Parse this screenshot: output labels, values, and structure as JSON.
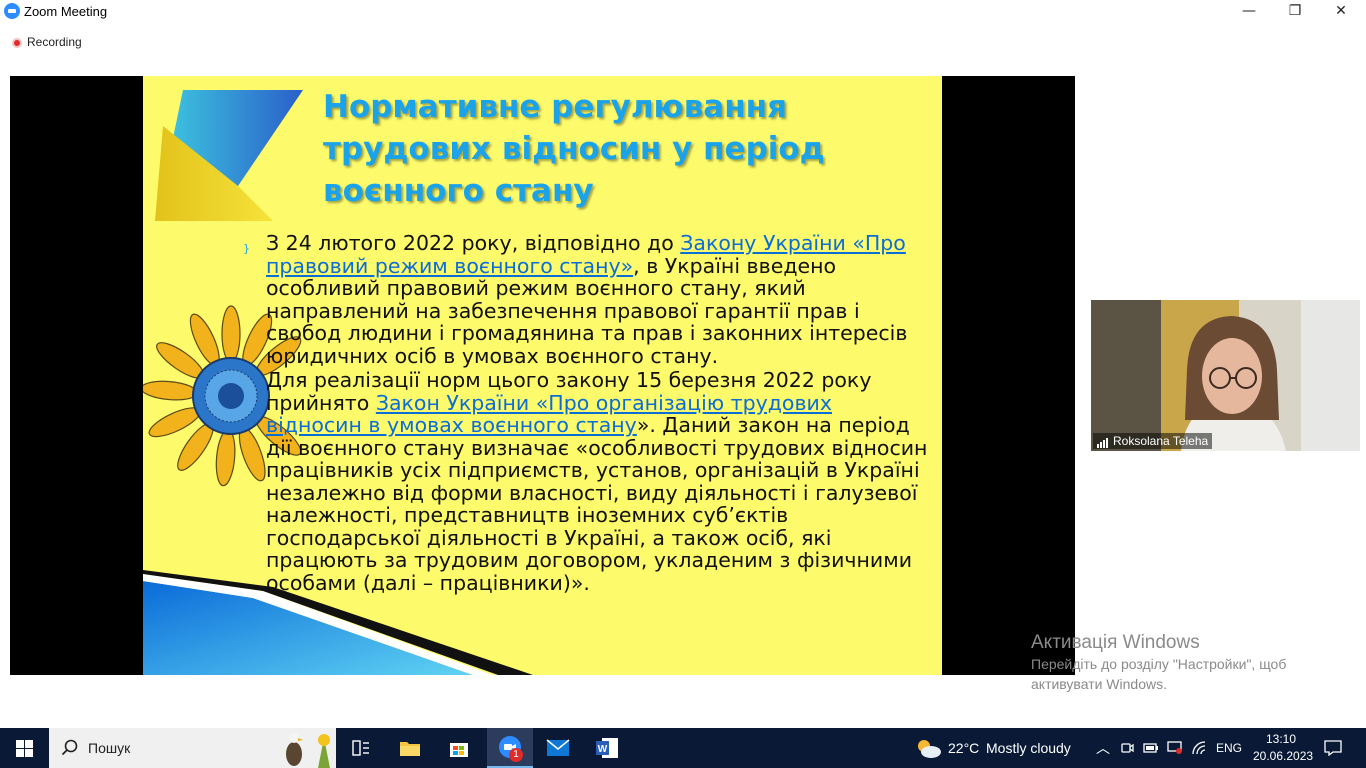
{
  "window": {
    "title": "Zoom Meeting",
    "minimize": "—",
    "maximize": "❐",
    "close": "✕"
  },
  "meeting": {
    "recording_label": "Recording"
  },
  "slide": {
    "title_lines": [
      "Нормативне регулювання",
      "трудових відносин у період",
      "воєнного стану"
    ],
    "bullet": "}",
    "p1_a": "З 24 лютого 2022 року, відповідно до ",
    "p1_link": "Закону України «Про правовий режим воєнного стану»",
    "p1_b": ", в Україні введено особливий правовий режим воєнного стану, який направлений на забезпечення правової гарантії прав і свобод людини і громадянина та прав і законних інтересів юридичних осіб в умовах воєнного стану.",
    "p2_a": "Для реалізації норм цього закону 15 березня 2022 року прийнято ",
    "p2_link": "Закон України «Про організацію трудових відносин в умовах воєнного стану",
    "p2_b": "». Даний закон на період дії воєнного стану визначає «особливості трудових відносин працівників усіх підприємств, установ, організацій в Україні незалежно від форми власності, виду діяльності і галузевої належності, представництв іноземних суб’єктів господарської діяльності в Україні, а також осіб, які працюють за трудовим договором, укладеним з фізичними особами (далі – працівники)»."
  },
  "participant": {
    "name": "Roksolana Teleha"
  },
  "watermark": {
    "heading": "Активація Windows",
    "line1": "Перейдіть до розділу \"Настройки\", щоб",
    "line2": "активувати Windows."
  },
  "taskbar": {
    "search_label": "Пошук",
    "zoom_badge": "1",
    "weather_temp": "22°C",
    "weather_desc": "Mostly cloudy",
    "language": "ENG",
    "time": "13:10",
    "date": "20.06.2023"
  },
  "colors": {
    "slide_bg": "#fdfb6b",
    "title_blue": "#1aa3e8",
    "link_blue": "#0b6dd6",
    "taskbar_bg": "#0a1a36"
  }
}
